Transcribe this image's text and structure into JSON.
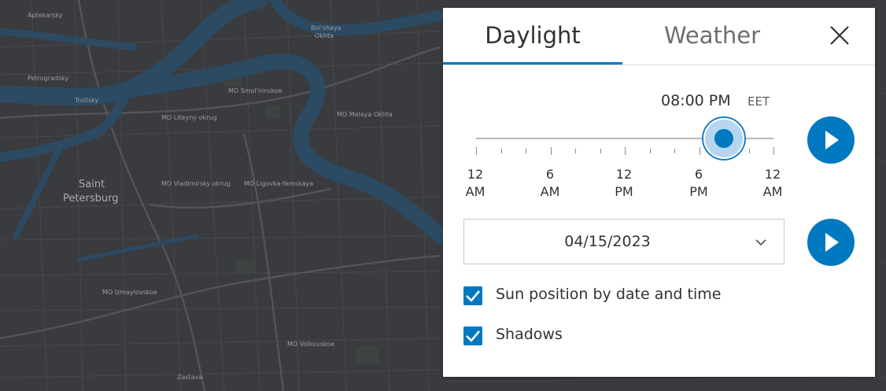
{
  "map": {
    "labels": {
      "aptekarsky": "Aptekarsky",
      "petrogradsky": "Petrogradsky",
      "troitsky": "Troitsky",
      "boltshaya": "Bol'shaya",
      "okhta": "Okhta",
      "smolninskoe": "MO Smol'ninskoe",
      "liteyny": "MO Liteyny okrug",
      "saint": "Saint",
      "petersburg": "Petersburg",
      "vladimirsky": "MO Vladimirsky okrug",
      "ligovka": "MO Ligovka-Yamskaya",
      "malaya": "MO Malaya Okhta",
      "izmaylovskoe": "MO Izmaylovskoe",
      "volkovskoe": "MO Volkovskoe",
      "zastava": "Zastava"
    }
  },
  "panel": {
    "tabs": [
      {
        "label": "Daylight",
        "active": true
      },
      {
        "label": "Weather",
        "active": false
      }
    ],
    "time": {
      "value": "08:00 PM",
      "timezone": "EET",
      "slider_fraction": 0.833
    },
    "ticks": [
      {
        "hour": "12",
        "period": "AM"
      },
      {
        "hour": "6",
        "period": "AM"
      },
      {
        "hour": "12",
        "period": "PM"
      },
      {
        "hour": "6",
        "period": "PM"
      },
      {
        "hour": "12",
        "period": "AM"
      }
    ],
    "date": {
      "value": "04/15/2023"
    },
    "options": [
      {
        "label": "Sun position by date and time",
        "checked": true
      },
      {
        "label": "Shadows",
        "checked": true
      }
    ]
  },
  "colors": {
    "accent": "#0079c1",
    "map_background": "#3a3b3e"
  },
  "icons": {
    "close": "close-icon",
    "play": "play-icon",
    "chevron": "chevron-down-icon",
    "check": "checkmark-icon"
  }
}
